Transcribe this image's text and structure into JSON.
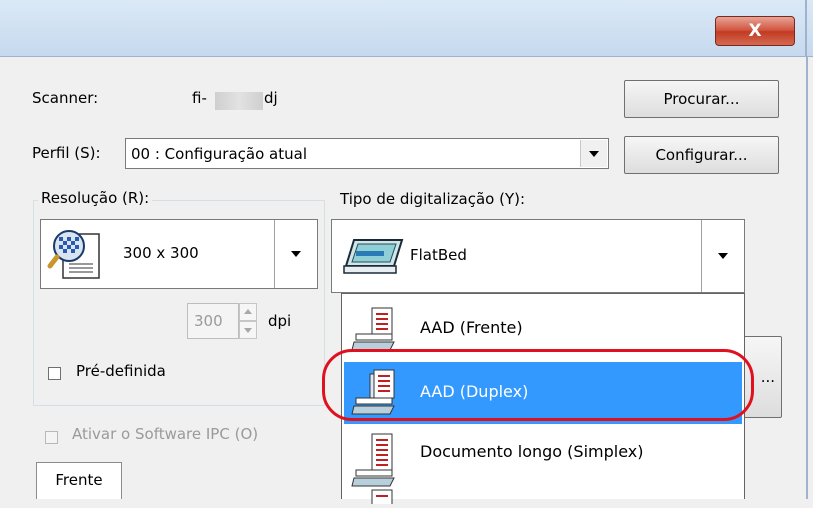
{
  "window": {
    "close_glyph": "X"
  },
  "scanner": {
    "label": "Scanner:",
    "model_prefix": "fi-",
    "model_suffix": "dj",
    "browse_button": "Procurar..."
  },
  "profile": {
    "label": "Perfil (S):",
    "value": "00 : Configuração atual",
    "configure_button": "Configurar..."
  },
  "resolution": {
    "group_label": "Resolução (R):",
    "value": "300 x 300",
    "custom_dpi": "300",
    "unit": "dpi",
    "preset_label": "Pré-definida"
  },
  "scan_type": {
    "label": "Tipo de digitalização (Y):",
    "current_value": "FlatBed",
    "options": [
      {
        "label": "AAD (Frente)",
        "icon": "adf-simplex-icon"
      },
      {
        "label": "AAD (Duplex)",
        "icon": "adf-duplex-icon"
      },
      {
        "label": "Documento longo (Simplex)",
        "icon": "long-document-icon"
      }
    ],
    "selected_option": "AAD (Duplex)"
  },
  "ipc": {
    "label": "Ativar o Software IPC (O)",
    "enabled": false
  },
  "tabs": {
    "front": "Frente"
  },
  "partial_button": {
    "label": "..."
  },
  "colors": {
    "selection": "#3399ff",
    "highlight_ring": "#e0101e",
    "close_button": "#c23a22"
  }
}
